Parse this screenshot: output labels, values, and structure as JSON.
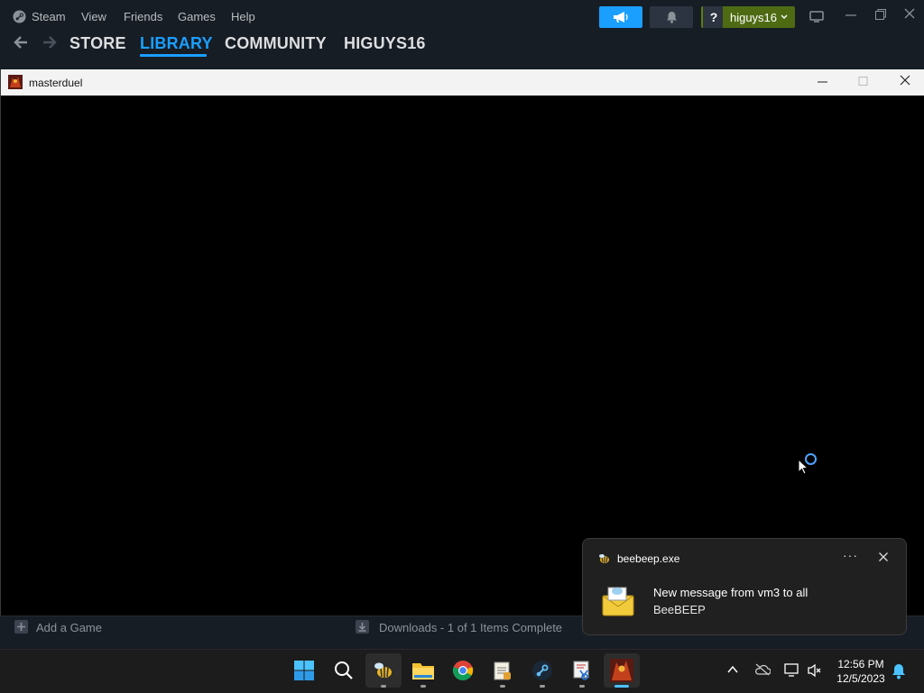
{
  "steam": {
    "menu": {
      "steam": "Steam",
      "view": "View",
      "friends": "Friends",
      "games": "Games",
      "help": "Help"
    },
    "help_label": "?",
    "account_name": "higuys16",
    "tabs": {
      "store": "STORE",
      "library": "LIBRARY",
      "community": "COMMUNITY",
      "profile": "HIGUYS16"
    },
    "active_tab": "LIBRARY",
    "bottom": {
      "add_game": "Add a Game",
      "downloads": "Downloads - 1 of 1 Items Complete"
    },
    "colors": {
      "accent": "#1a9fff",
      "account_green": "#4e6b14",
      "background": "#171d25"
    }
  },
  "game_window": {
    "title": "masterduel"
  },
  "toast": {
    "app_name": "beebeep.exe",
    "more": "···",
    "title": "New message from vm3 to all",
    "body": "BeeBEEP"
  },
  "taskbar": {
    "apps": [
      "start-icon",
      "search-icon",
      "beebeep-icon",
      "file-explorer-icon",
      "chrome-icon",
      "notepad-icon",
      "steam-icon",
      "snipping-tool-icon",
      "masterduel-icon"
    ],
    "time": "12:56 PM",
    "date": "12/5/2023"
  }
}
